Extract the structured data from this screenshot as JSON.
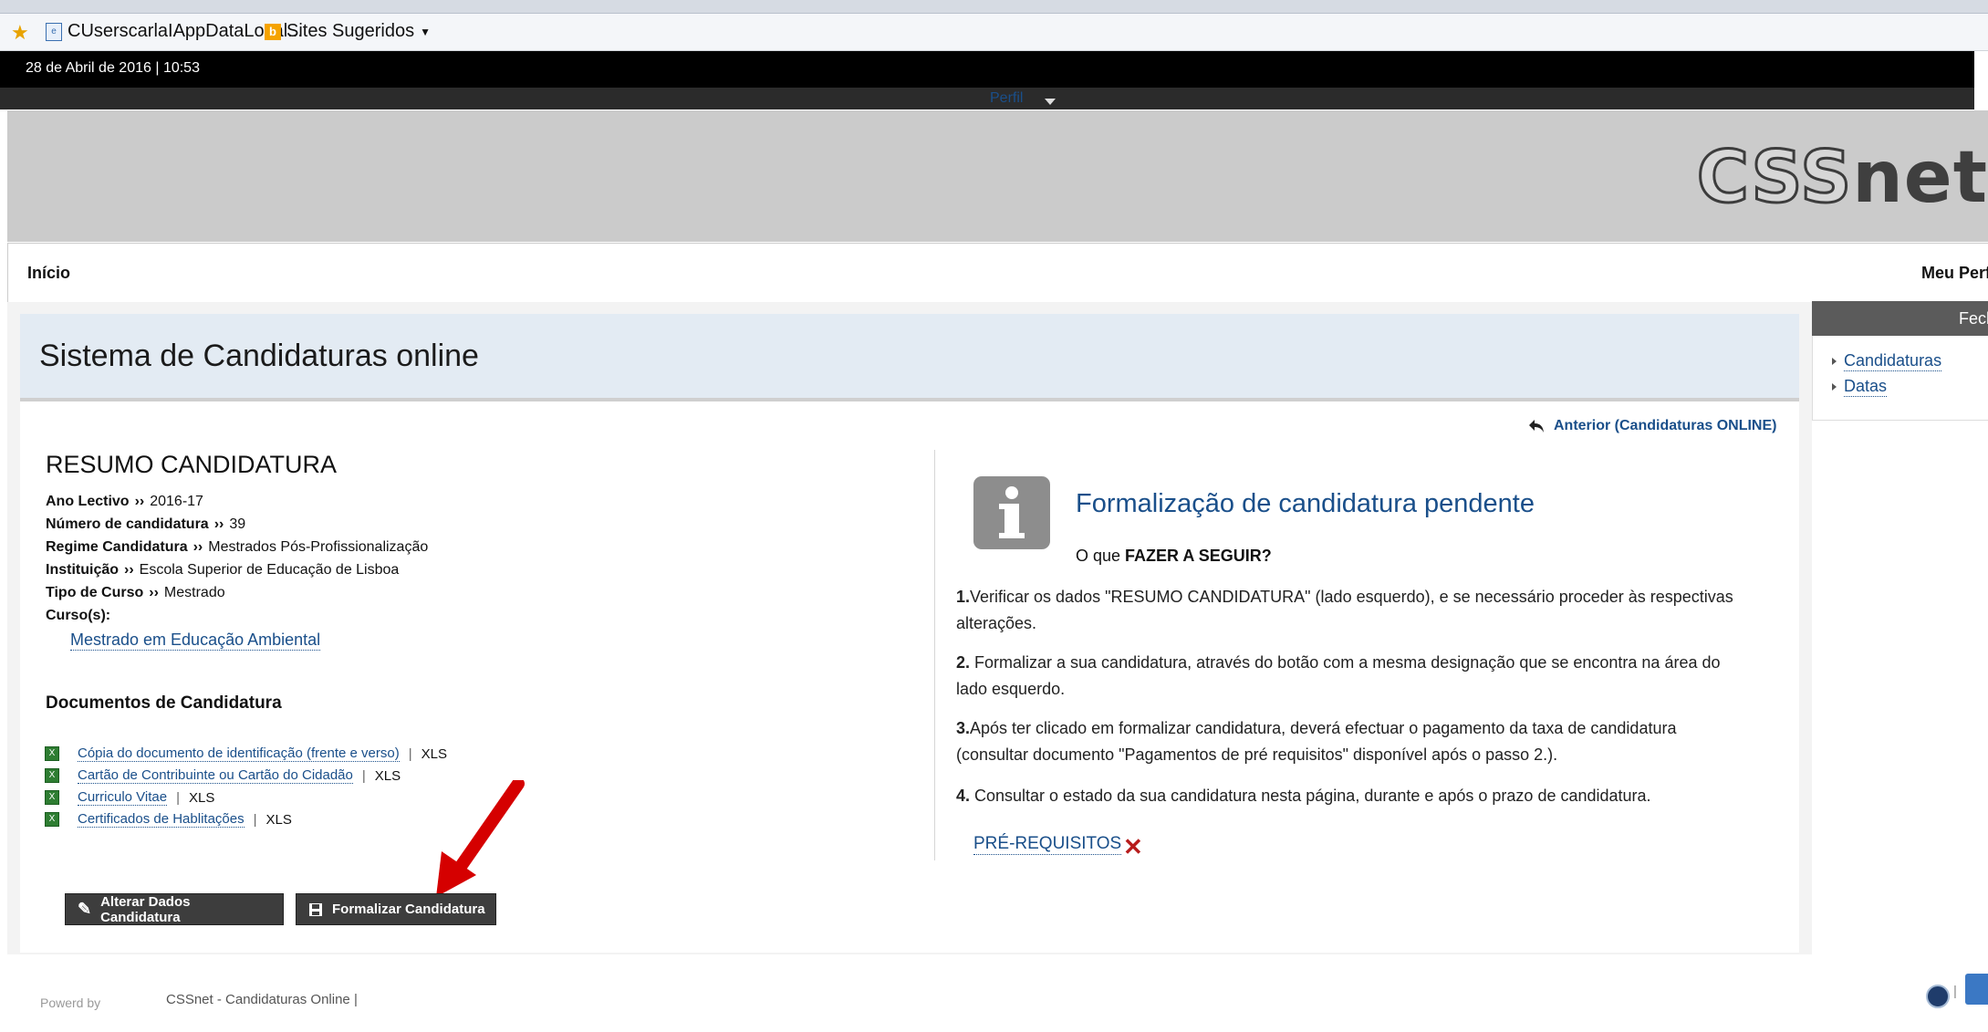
{
  "browser": {
    "fav_items": [
      {
        "label": "CUserscarlaIAppDataLocal...",
        "icon": "page-icon"
      },
      {
        "label": "Sites Sugeridos",
        "icon": "bing-icon"
      }
    ]
  },
  "header": {
    "datetime": "28 de Abril de 2016 | 10:53",
    "gray_bar_text": "Perfil",
    "logo": "CSSnet"
  },
  "nav": {
    "home": "Início",
    "profile": "Meu Perfil"
  },
  "page": {
    "title": "Sistema de Candidaturas online",
    "back_link": "Anterior (Candidaturas ONLINE)"
  },
  "summary": {
    "heading": "RESUMO CANDIDATURA",
    "fields": [
      {
        "label": "Ano Lectivo",
        "value": "2016-17"
      },
      {
        "label": "Número de candidatura",
        "value": "39"
      },
      {
        "label": "Regime Candidatura",
        "value": "Mestrados Pós-Profissionalização"
      },
      {
        "label": "Instituição",
        "value": "Escola Superior de Educação de Lisboa"
      },
      {
        "label": "Tipo de Curso",
        "value": "Mestrado"
      }
    ],
    "courses_label": "Curso(s):",
    "course": "Mestrado em Educação Ambiental",
    "separator": "››"
  },
  "documents": {
    "heading": "Documentos de Candidatura",
    "items": [
      {
        "label": "Cópia do documento de identificação (frente e verso)",
        "type": "XLS"
      },
      {
        "label": "Cartão de Contribuinte ou Cartão do Cidadão",
        "type": "XLS"
      },
      {
        "label": "Curriculo Vitae",
        "type": "XLS"
      },
      {
        "label": "Certificados de Hablitações",
        "type": "XLS"
      }
    ],
    "pipe": "|"
  },
  "buttons": {
    "alter": "Alterar Dados Candidatura",
    "formalize": "Formalizar Candidatura"
  },
  "info": {
    "title": "Formalização de candidatura pendente",
    "what_next_prefix": "O que ",
    "what_next_bold": "FAZER A SEGUIR?",
    "steps": [
      {
        "num": "1.",
        "text": "Verificar os dados \"RESUMO CANDIDATURA\" (lado esquerdo), e se necessário proceder às respectivas alterações."
      },
      {
        "num": "2.",
        "text": " Formalizar a sua candidatura, através do botão com a mesma designação que se encontra na área do lado esquerdo."
      },
      {
        "num": "3.",
        "text": "Após ter clicado em formalizar candidatura, deverá efectuar o pagamento da taxa de candidatura (consultar documento \"Pagamentos de pré requisitos\" disponível após o passo 2.)."
      },
      {
        "num": "4.",
        "text": " Consultar o estado da sua candidatura nesta página, durante e após o prazo de candidatura."
      }
    ],
    "prereq_link": "PRÉ-REQUISITOS",
    "prereq_status": "✕"
  },
  "sidebar": {
    "header": "Fechar",
    "items": [
      "Candidaturas",
      "Datas"
    ]
  },
  "footer": {
    "powered": "Powerd by",
    "link": "CSSnet - Candidaturas Online |",
    "bar": "|"
  },
  "colors": {
    "link": "#1a4f8a",
    "button_bg": "#3d3d3d",
    "title_bg": "#e3ebf3",
    "arrow": "#d50000"
  }
}
